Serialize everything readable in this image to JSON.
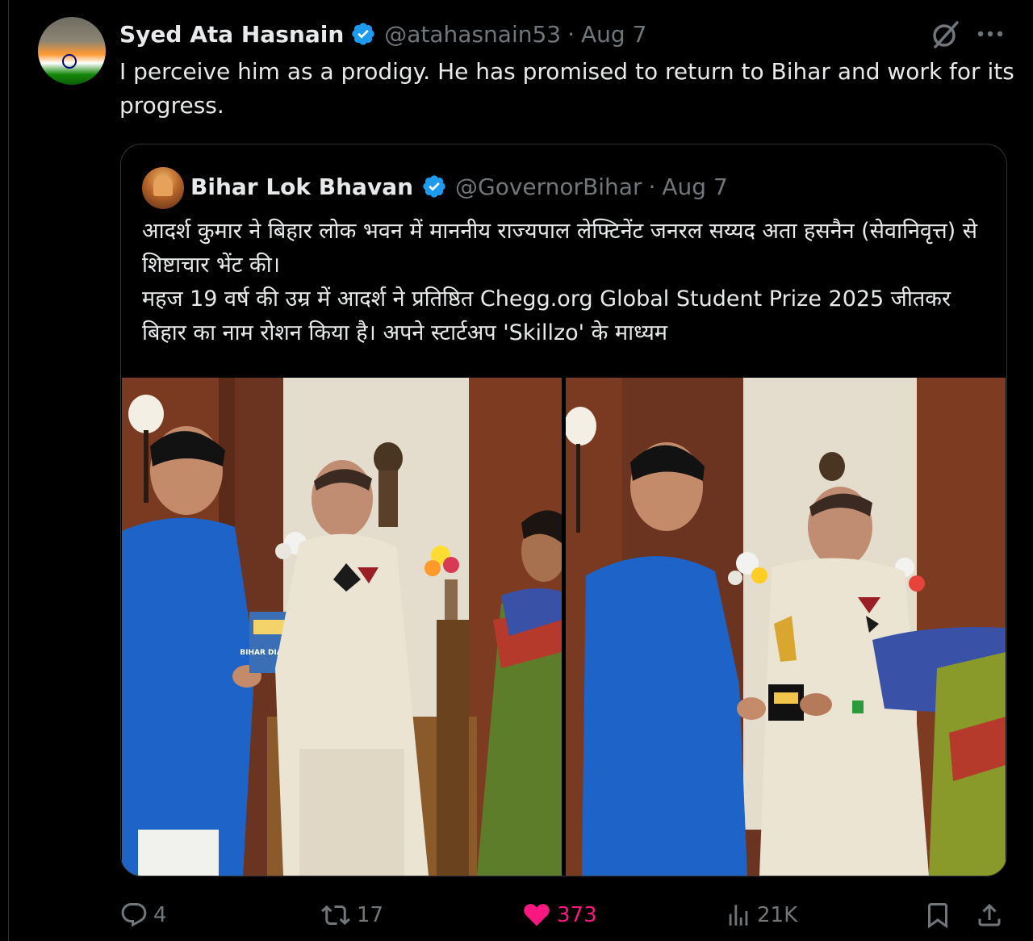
{
  "tweet": {
    "author_name": "Syed Ata Hasnain",
    "handle": "@atahasnain53",
    "separator": "·",
    "date": "Aug 7",
    "text": "I perceive him as a prodigy. He has promised to return to Bihar and work for its progress."
  },
  "quoted": {
    "author_name": "Bihar Lok Bhavan",
    "handle": "@GovernorBihar",
    "separator": "·",
    "date": "Aug 7",
    "text_line_1": "आदर्श कुमार ने बिहार लोक भवन में माननीय राज्यपाल लेफ्टिनेंट जनरल सय्यद अता हसनैन (सेवानिवृत्त) से शिष्टाचार भेंट की।",
    "text_line_2": "महज 19 वर्ष की उम्र में आदर्श ने प्रतिष्ठित Chegg.org Global Student Prize 2025 जीतकर बिहार का नाम रोशन किया है। अपने स्टार्टअप  'Skillzo'  के माध्यम",
    "photo_book_title": "BIHAR DIARIES"
  },
  "actions": {
    "replies": "4",
    "reposts": "17",
    "likes": "373",
    "views": "21K"
  },
  "icons": {
    "verified": "verified-badge-icon",
    "grok": "grok-icon",
    "more": "more-icon",
    "reply": "reply-icon",
    "repost": "repost-icon",
    "like": "heart-icon",
    "views": "views-icon",
    "bookmark": "bookmark-icon",
    "share": "share-icon"
  },
  "colors": {
    "background": "#000000",
    "text": "#e7e9ea",
    "muted": "#71767b",
    "verified": "#1d9bf0",
    "like": "#f91880",
    "border": "#2f3336"
  }
}
